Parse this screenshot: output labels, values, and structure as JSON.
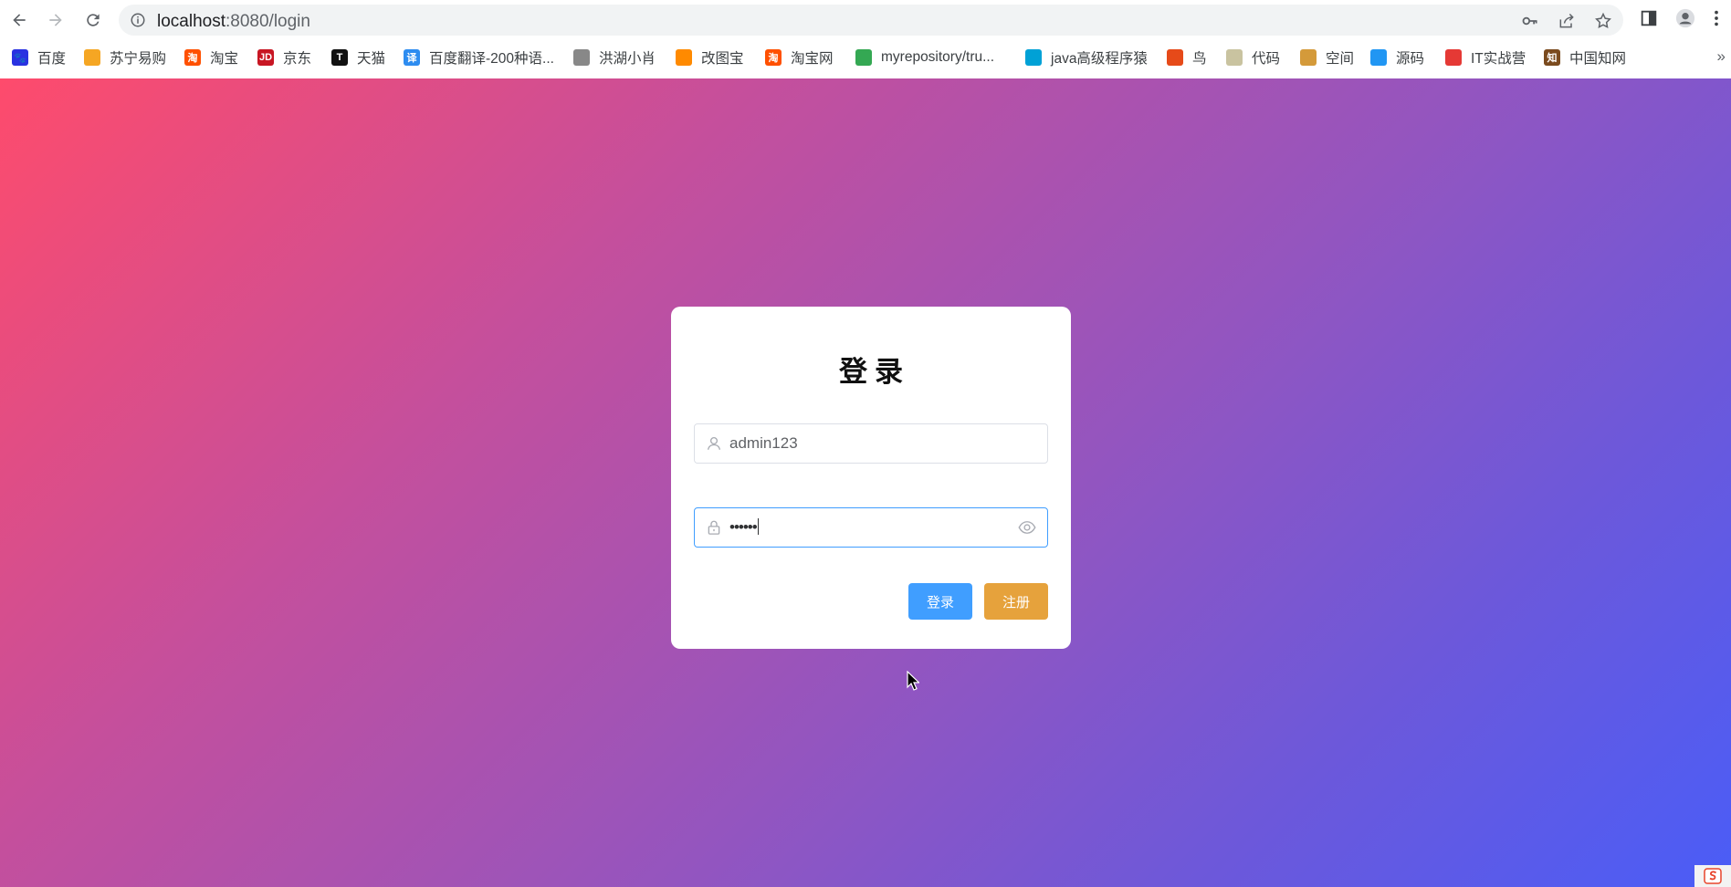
{
  "browser": {
    "url_host": "localhost",
    "url_path": ":8080/login",
    "bookmarks": [
      {
        "label": "百度",
        "color": "#2932e1",
        "glyph": "🐾"
      },
      {
        "label": "苏宁易购",
        "color": "#f5a623",
        "glyph": ""
      },
      {
        "label": "淘宝",
        "color": "#ff5000",
        "glyph": "淘"
      },
      {
        "label": "京东",
        "color": "#c81623",
        "glyph": "JD"
      },
      {
        "label": "天猫",
        "color": "#111111",
        "glyph": "T"
      },
      {
        "label": "百度翻译-200种语...",
        "color": "#2d8cf0",
        "glyph": "译"
      },
      {
        "label": "洪湖小肖",
        "color": "#888888",
        "glyph": ""
      },
      {
        "label": "改图宝",
        "color": "#ff8a00",
        "glyph": ""
      },
      {
        "label": "淘宝网",
        "color": "#ff5000",
        "glyph": "淘"
      },
      {
        "label": "myrepository/tru...",
        "color": "#34a853",
        "glyph": ""
      },
      {
        "label": "java高级程序猿",
        "color": "#00a1d6",
        "glyph": ""
      },
      {
        "label": "鸟",
        "color": "#e64a19",
        "glyph": ""
      },
      {
        "label": "代码",
        "color": "#c9c3a0",
        "glyph": ""
      },
      {
        "label": "空间",
        "color": "#d49a3a",
        "glyph": ""
      },
      {
        "label": "源码",
        "color": "#2196f3",
        "glyph": ""
      },
      {
        "label": "IT实战营",
        "color": "#e53935",
        "glyph": ""
      },
      {
        "label": "中国知网",
        "color": "#7a4a1e",
        "glyph": "知"
      }
    ],
    "more_label": "»"
  },
  "login": {
    "title": "登录",
    "username_value": "admin123",
    "password_value": "••••••",
    "login_label": "登录",
    "register_label": "注册"
  },
  "colors": {
    "primary": "#409eff",
    "warning": "#e6a23c"
  }
}
